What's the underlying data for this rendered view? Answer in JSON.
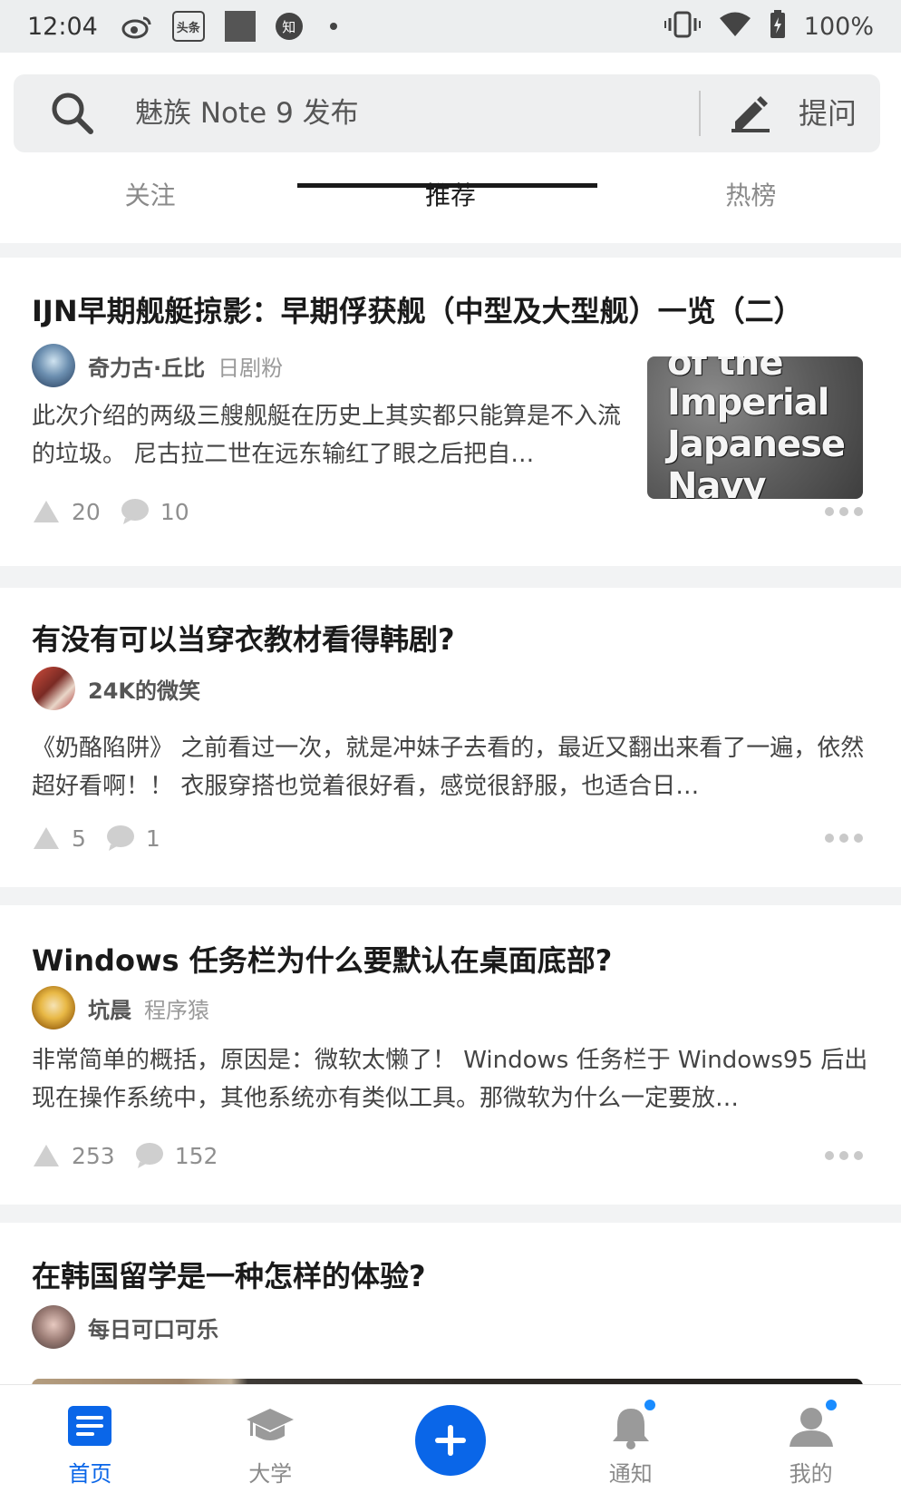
{
  "status_bar": {
    "time": "12:04",
    "battery": "100%",
    "icons": [
      "weibo-icon",
      "toutiao-icon",
      "gallery-icon",
      "zhihu-icon",
      "dot-icon",
      "vibrate-icon",
      "wifi-icon",
      "battery-icon"
    ],
    "toutiao_text": "头条",
    "zhihu_text": "知"
  },
  "search": {
    "placeholder": "魅族 Note 9 发布",
    "ask_label": "提问"
  },
  "tabs": [
    {
      "label": "关注",
      "active": false
    },
    {
      "label": "推荐",
      "active": true
    },
    {
      "label": "热榜",
      "active": false
    }
  ],
  "feed": [
    {
      "title": "IJN早期舰艇掠影：早期俘获舰（中型及大型舰）一览（二）",
      "author": "奇力古·丘比",
      "tag": "日剧粉",
      "excerpt": "此次介绍的两级三艘舰艇在历史上其实都只能算是不入流的垃圾。 尼古拉二世在远东输红了眼之后把自…",
      "likes": "20",
      "comments": "10",
      "thumbnail_text": [
        "of the",
        "Imperial",
        "Japanese",
        "Navy"
      ]
    },
    {
      "title": "有没有可以当穿衣教材看得韩剧?",
      "author": "24K的微笑",
      "tag": "",
      "excerpt": "《奶酪陷阱》 之前看过一次，就是冲妹子去看的，最近又翻出来看了一遍，依然超好看啊！！ 衣服穿搭也觉着很好看，感觉很舒服，也适合日…",
      "likes": "5",
      "comments": "1"
    },
    {
      "title": "Windows 任务栏为什么要默认在桌面底部?",
      "author": "坑晨",
      "tag": "程序猿",
      "excerpt": "非常简单的概括，原因是：微软太懒了！ Windows 任务栏于 Windows95 后出现在操作系统中，其他系统亦有类似工具。那微软为什么一定要放…",
      "likes": "253",
      "comments": "152"
    },
    {
      "title": "在韩国留学是一种怎样的体验?",
      "author": "每日可口可乐",
      "tag": ""
    }
  ],
  "bottom_nav": [
    {
      "label": "首页",
      "icon": "home-doc-icon",
      "active": true
    },
    {
      "label": "大学",
      "icon": "graduation-cap-icon",
      "active": false
    },
    {
      "label": "",
      "icon": "plus-icon",
      "active": false
    },
    {
      "label": "通知",
      "icon": "bell-icon",
      "active": false
    },
    {
      "label": "我的",
      "icon": "person-icon",
      "active": false
    }
  ],
  "colors": {
    "accent": "#0a66e8",
    "badge": "#1a8cff",
    "background": "#f2f3f4"
  }
}
